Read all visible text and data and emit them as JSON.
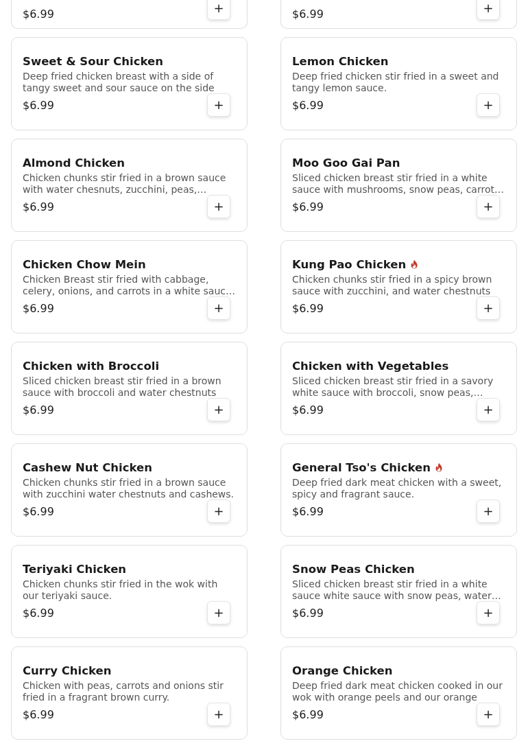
{
  "menu_items": [
    {
      "kind": "partial",
      "price": "$6.99"
    },
    {
      "kind": "partial",
      "price": "$6.99"
    },
    {
      "kind": "full",
      "name": "Sweet & Sour Chicken",
      "spicy": false,
      "description": "Deep fried chicken breast with a side of tangy sweet and sour sauce on the side",
      "price": "$6.99"
    },
    {
      "kind": "full",
      "name": "Lemon Chicken",
      "spicy": false,
      "description": "Deep fried chicken stir fried in a sweet and tangy lemon sauce.",
      "price": "$6.99"
    },
    {
      "kind": "full",
      "name": "Almond Chicken",
      "spicy": false,
      "description": "Chicken chunks stir fried in a brown sauce with water chesnuts, zucchini, peas,…",
      "price": "$6.99"
    },
    {
      "kind": "full",
      "name": "Moo Goo Gai Pan",
      "spicy": false,
      "description": "Sliced chicken breast stir fried in a white sauce with mushrooms, snow peas, carrot…",
      "price": "$6.99"
    },
    {
      "kind": "full",
      "name": "Chicken Chow Mein",
      "spicy": false,
      "description": "Chicken Breast stir fried with cabbage, celery, onions, and carrots in a white sauc…",
      "price": "$6.99"
    },
    {
      "kind": "full",
      "name": "Kung Pao Chicken",
      "spicy": true,
      "description": "Chicken chunks stir fried in a spicy brown sauce with zucchini, and water chestnuts",
      "price": "$6.99"
    },
    {
      "kind": "full",
      "name": "Chicken with Broccoli",
      "spicy": false,
      "description": "Sliced chicken breast stir fried in a brown sauce with broccoli and water chestnuts",
      "price": "$6.99"
    },
    {
      "kind": "full",
      "name": "Chicken with Vegetables",
      "spicy": false,
      "description": "Sliced chicken breast stir fried in a savory white sauce with broccoli, snow peas,…",
      "price": "$6.99"
    },
    {
      "kind": "full",
      "name": "Cashew Nut Chicken",
      "spicy": false,
      "description": "Chicken chunks stir fried in a brown sauce with zucchini water chestnuts and cashews.",
      "price": "$6.99"
    },
    {
      "kind": "full",
      "name": "General Tso's Chicken",
      "spicy": true,
      "description": "Deep fried dark meat chicken with a sweet, spicy and fragrant sauce.",
      "price": "$6.99"
    },
    {
      "kind": "full",
      "name": "Teriyaki Chicken",
      "spicy": false,
      "description": "Chicken chunks stir fried in the wok with our teriyaki sauce.",
      "price": "$6.99"
    },
    {
      "kind": "full",
      "name": "Snow Peas Chicken",
      "spicy": false,
      "description": "Sliced chicken breast stir fried in a white sauce white sauce with snow peas, water…",
      "price": "$6.99"
    },
    {
      "kind": "full",
      "name": "Curry Chicken",
      "spicy": false,
      "description": "Chicken with peas, carrots and onions stir fried in a fragrant brown curry.",
      "price": "$6.99"
    },
    {
      "kind": "full",
      "name": "Orange Chicken",
      "spicy": false,
      "description": "Deep fried dark meat chicken cooked in our wok with orange peels and our orange",
      "price": "$6.99"
    }
  ],
  "add_button": {
    "label": "+"
  }
}
